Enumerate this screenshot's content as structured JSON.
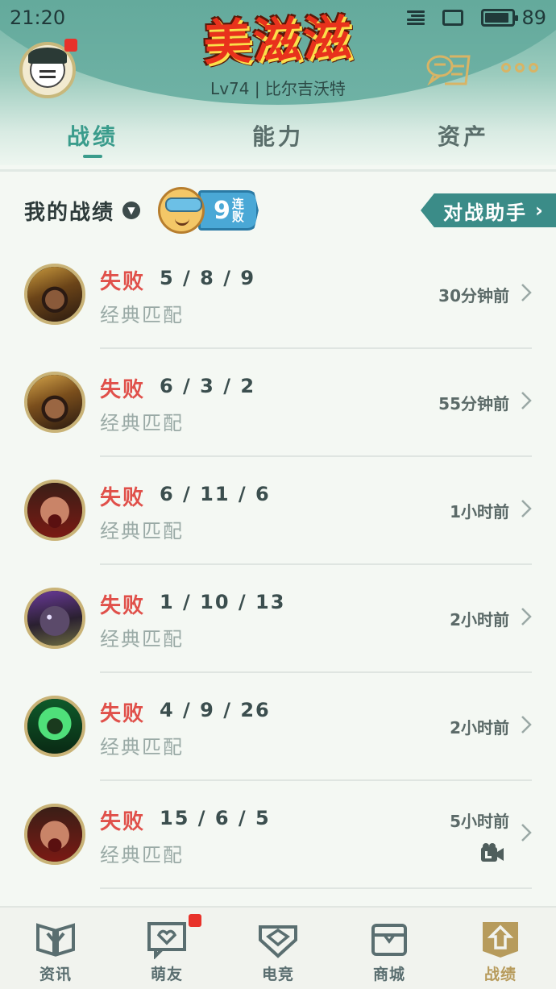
{
  "status_bar": {
    "time": "21:20",
    "battery": "89"
  },
  "header": {
    "logo_text": "美滋滋",
    "level_text": "Lv74 | 比尔吉沃特"
  },
  "tabs": [
    {
      "label": "战绩",
      "active": true
    },
    {
      "label": "能力",
      "active": false
    },
    {
      "label": "资产",
      "active": false
    }
  ],
  "section": {
    "title": "我的战绩",
    "streak_count": "9",
    "streak_word": "连败",
    "assist_button": "对战助手"
  },
  "matches": [
    {
      "result": "失败",
      "kda": "5 / 8 / 9",
      "mode": "经典匹配",
      "time": "30分钟前",
      "hero_icon": "golden-helmet-warrior",
      "video": false
    },
    {
      "result": "失败",
      "kda": "6 / 3 / 2",
      "mode": "经典匹配",
      "time": "55分钟前",
      "hero_icon": "golden-helmet-warrior",
      "video": false
    },
    {
      "result": "失败",
      "kda": "6 / 11 / 6",
      "mode": "经典匹配",
      "time": "1小时前",
      "hero_icon": "roaring-warrior",
      "video": false
    },
    {
      "result": "失败",
      "kda": "1 / 10 / 13",
      "mode": "经典匹配",
      "time": "2小时前",
      "hero_icon": "purple-shadow-assassin",
      "video": false
    },
    {
      "result": "失败",
      "kda": "4 / 9 / 26",
      "mode": "经典匹配",
      "time": "2小时前",
      "hero_icon": "green-warden",
      "video": false
    },
    {
      "result": "失败",
      "kda": "15 / 6 / 5",
      "mode": "经典匹配",
      "time": "5小时前",
      "hero_icon": "roaring-warrior",
      "video": true
    }
  ],
  "bottom_nav": [
    {
      "label": "资讯",
      "icon": "book-icon",
      "active": false,
      "badge": false
    },
    {
      "label": "萌友",
      "icon": "chat-heart-icon",
      "active": false,
      "badge": true
    },
    {
      "label": "电竞",
      "icon": "esports-shield-icon",
      "active": false,
      "badge": false
    },
    {
      "label": "商城",
      "icon": "chest-icon",
      "active": false,
      "badge": false
    },
    {
      "label": "战绩",
      "icon": "battle-record-icon",
      "active": true,
      "badge": false
    }
  ],
  "colors": {
    "accent": "#3a9c8c",
    "loss_red": "#e0504a",
    "gold": "#b79b5c",
    "assist_button": "#3b8c88"
  }
}
